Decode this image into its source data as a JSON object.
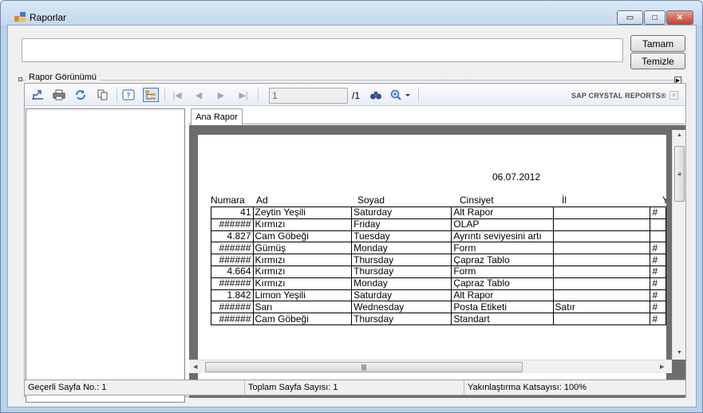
{
  "window": {
    "title": "Raporlar",
    "minimize_glyph": "▭",
    "maximize_glyph": "□",
    "close_glyph": "✕"
  },
  "form": {
    "input_value": "",
    "ok_label": "Tamam",
    "clear_label": "Temizle",
    "group_label": "Rapor Görünümü"
  },
  "toolbar": {
    "page_value": "1",
    "page_total": "/1",
    "brand": "SAP CRYSTAL REPORTS®",
    "icons": [
      "export-icon",
      "print-icon",
      "refresh-icon",
      "copy-icon",
      "help-icon",
      "group-tree-icon",
      "first-page-icon",
      "prev-page-icon",
      "next-page-icon",
      "last-page-icon",
      "find-icon",
      "zoom-icon"
    ]
  },
  "tabs": {
    "main": "Ana Rapor"
  },
  "report": {
    "date": "06.07.2012",
    "headers": [
      "Numara",
      "Ad",
      "Soyad",
      "Cinsiyet",
      "İl",
      "Y"
    ],
    "rows": [
      [
        "41",
        "Zeytin Yeşili",
        "Saturday",
        "Alt Rapor",
        "",
        "#"
      ],
      [
        "######",
        "Kırmızı",
        "Friday",
        "OLAP",
        "",
        ""
      ],
      [
        "4.827",
        "Cam Göbeği",
        "Tuesday",
        "Ayrıntı seviyesini artı",
        "",
        ""
      ],
      [
        "######",
        "Gümüş",
        "Monday",
        "Form",
        "",
        "#"
      ],
      [
        "######",
        "Kırmızı",
        "Thursday",
        "Çapraz Tablo",
        "",
        "#"
      ],
      [
        "4.664",
        "Kırmızı",
        "Thursday",
        "Form",
        "",
        "#"
      ],
      [
        "######",
        "Kırmızı",
        "Monday",
        "Çapraz Tablo",
        "",
        "#"
      ],
      [
        "1.842",
        "Limon Yeşili",
        "Saturday",
        "Alt Rapor",
        "",
        "#"
      ],
      [
        "######",
        "Sarı",
        "Wednesday",
        "Posta Etiketi",
        "Satır",
        "#"
      ],
      [
        "######",
        "Cam Göbeği",
        "Thursday",
        "Standart",
        "",
        "#"
      ]
    ]
  },
  "status": {
    "current_page": "Geçerli Sayfa No.: 1",
    "total_pages": "Toplam Sayfa Sayısı: 1",
    "zoom": "Yakınlaştırma Katsayısı: 100%"
  }
}
